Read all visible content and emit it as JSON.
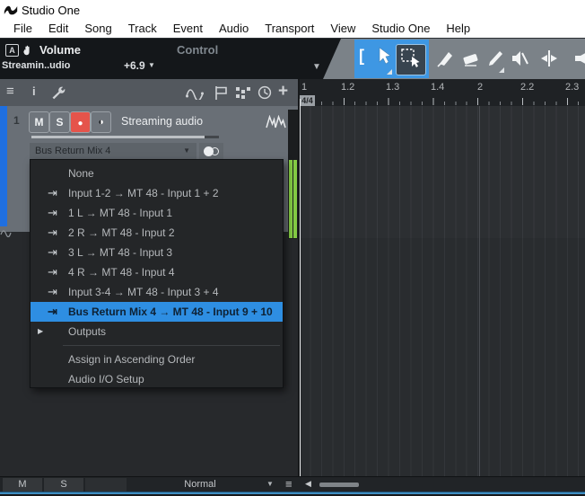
{
  "window": {
    "title": "Studio One"
  },
  "menubar": {
    "items": [
      "File",
      "Edit",
      "Song",
      "Track",
      "Event",
      "Audio",
      "Transport",
      "View",
      "Studio One",
      "Help"
    ]
  },
  "toolbar": {
    "auto_badge": "A",
    "param_label": "Volume",
    "target_label": "Control",
    "track_name": "Streamin..udio",
    "param_value": "+6.9"
  },
  "ruler": {
    "time_signature": "4/4",
    "ticks": [
      "1",
      "1.2",
      "1.3",
      "1.4",
      "2",
      "2.2",
      "2.3"
    ]
  },
  "track": {
    "number": "1",
    "mute": "M",
    "solo": "S",
    "name": "Streaming audio",
    "input": "Bus Return Mix 4"
  },
  "input_menu": {
    "items": [
      {
        "label": "None"
      },
      {
        "label": "Input 1-2 → MT 48 - Input 1 + 2"
      },
      {
        "label": "1 L → MT 48 - Input 1"
      },
      {
        "label": "2 R → MT 48 - Input 2"
      },
      {
        "label": "3 L → MT 48 - Input 3"
      },
      {
        "label": "4 R → MT 48 - Input 4"
      },
      {
        "label": "Input 3-4 → MT 48 - Input 3 + 4"
      },
      {
        "label": "Bus Return Mix 4 → MT 48 - Input 9 + 10",
        "selected": true
      },
      {
        "label": "Outputs",
        "has_submenu": true
      }
    ],
    "actions": [
      "Assign in Ascending Order",
      "Audio I/O Setup"
    ]
  },
  "bottom_bar": {
    "mute": "M",
    "solo": "S",
    "mode": "Normal"
  },
  "glyphs": {
    "hamburger": "≡",
    "info": "i",
    "plus": "+",
    "bracket": "[",
    "caret_down": "▼",
    "caret_right": "▶",
    "caret_left": "◀",
    "record": "●",
    "monitor_half": "◐",
    "route_arrow": "⇥"
  },
  "colors": {
    "accent_blue": "#3e97e3",
    "selection_blue": "#2e8ee2",
    "record_red": "#e5544b",
    "meter_green": "#84cb44",
    "track_color": "#1f6fe0"
  }
}
